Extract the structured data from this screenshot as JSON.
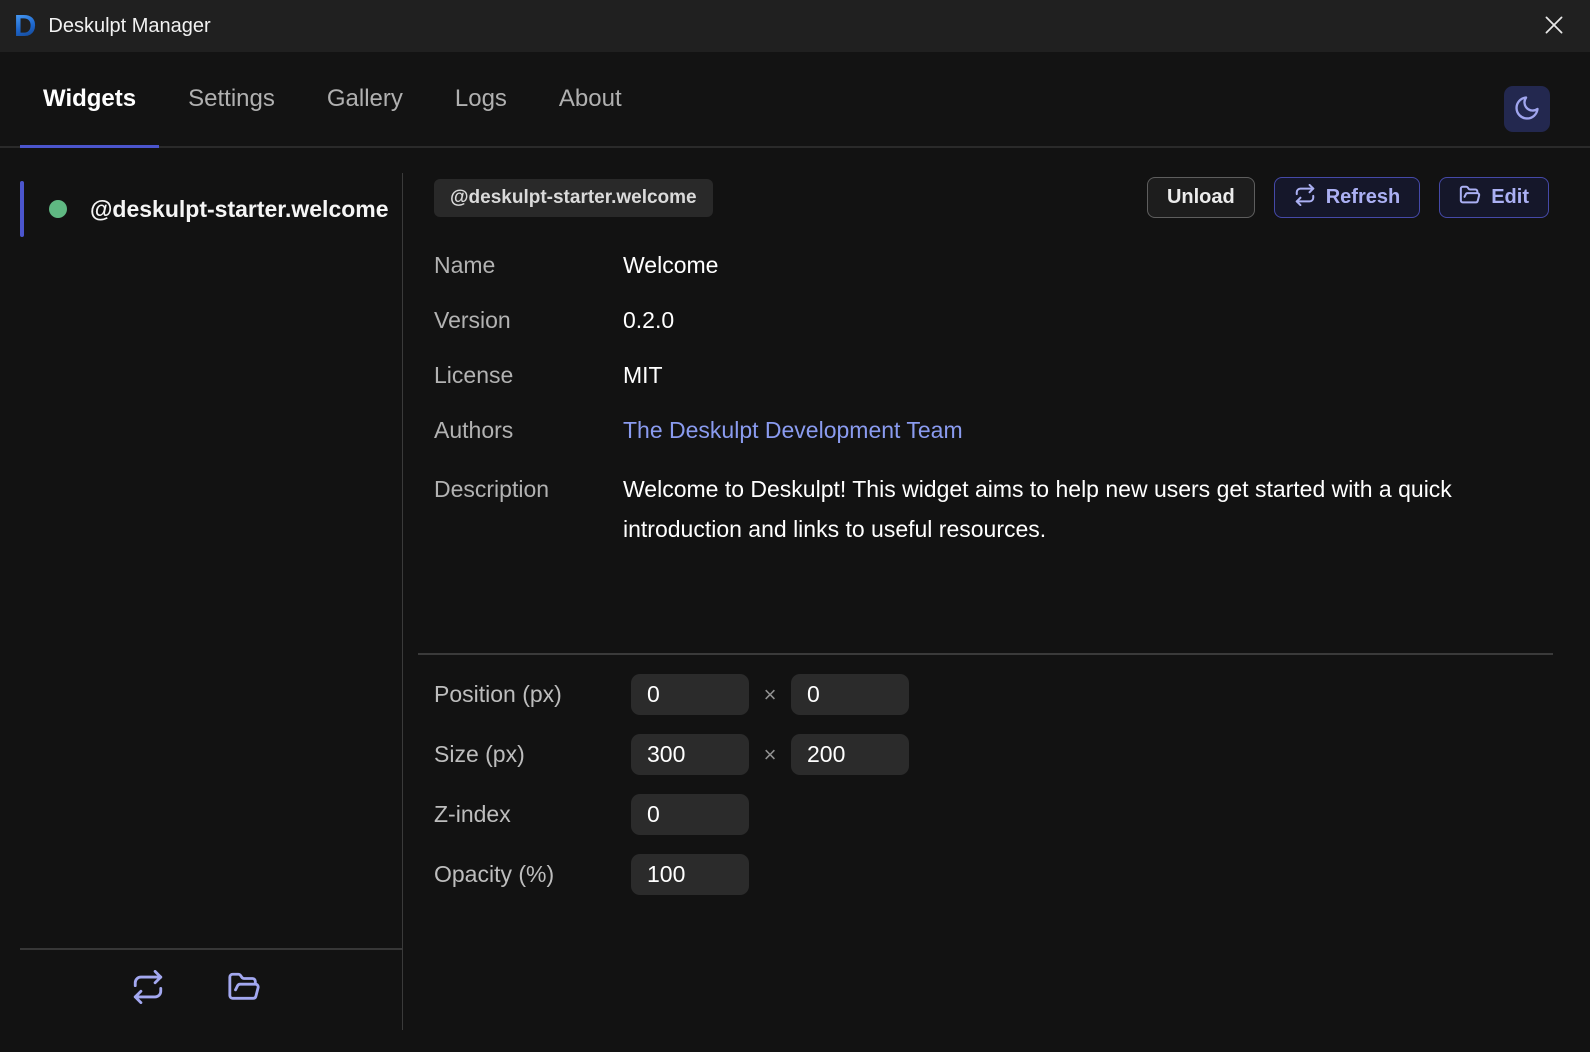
{
  "titlebar": {
    "logo_glyph": "D",
    "title": "Deskulpt Manager"
  },
  "tabs": {
    "items": [
      {
        "label": "Widgets"
      },
      {
        "label": "Settings"
      },
      {
        "label": "Gallery"
      },
      {
        "label": "Logs"
      },
      {
        "label": "About"
      }
    ],
    "active": "Widgets"
  },
  "sidebar": {
    "widget": {
      "id": "@deskulpt-starter.welcome"
    }
  },
  "detail": {
    "badge": "@deskulpt-starter.welcome",
    "unload_label": "Unload",
    "refresh_label": "Refresh",
    "edit_label": "Edit",
    "fields": {
      "name": {
        "label": "Name",
        "value": "Welcome"
      },
      "version": {
        "label": "Version",
        "value": "0.2.0"
      },
      "license": {
        "label": "License",
        "value": "MIT"
      },
      "authors": {
        "label": "Authors",
        "value": "The Deskulpt Development Team"
      },
      "description": {
        "label": "Description",
        "value": "Welcome to Deskulpt! This widget aims to help new users get started with a quick introduction and links to useful resources."
      }
    },
    "settings": {
      "position": {
        "label": "Position (px)",
        "x": "0",
        "y": "0"
      },
      "size": {
        "label": "Size (px)",
        "width": "300",
        "height": "200"
      },
      "zindex": {
        "label": "Z-index",
        "value": "0"
      },
      "opacity": {
        "label": "Opacity (%)",
        "value": "100"
      },
      "separator": "×"
    }
  },
  "colors": {
    "accent": "#4b55cd",
    "accent_border": "#4549a8",
    "accent_text": "#abb0f3",
    "link": "#8a9bef",
    "status_green": "#5fb882",
    "titlebar_bg": "#202020",
    "app_bg": "#121212",
    "input_bg": "#2b2b2b"
  }
}
